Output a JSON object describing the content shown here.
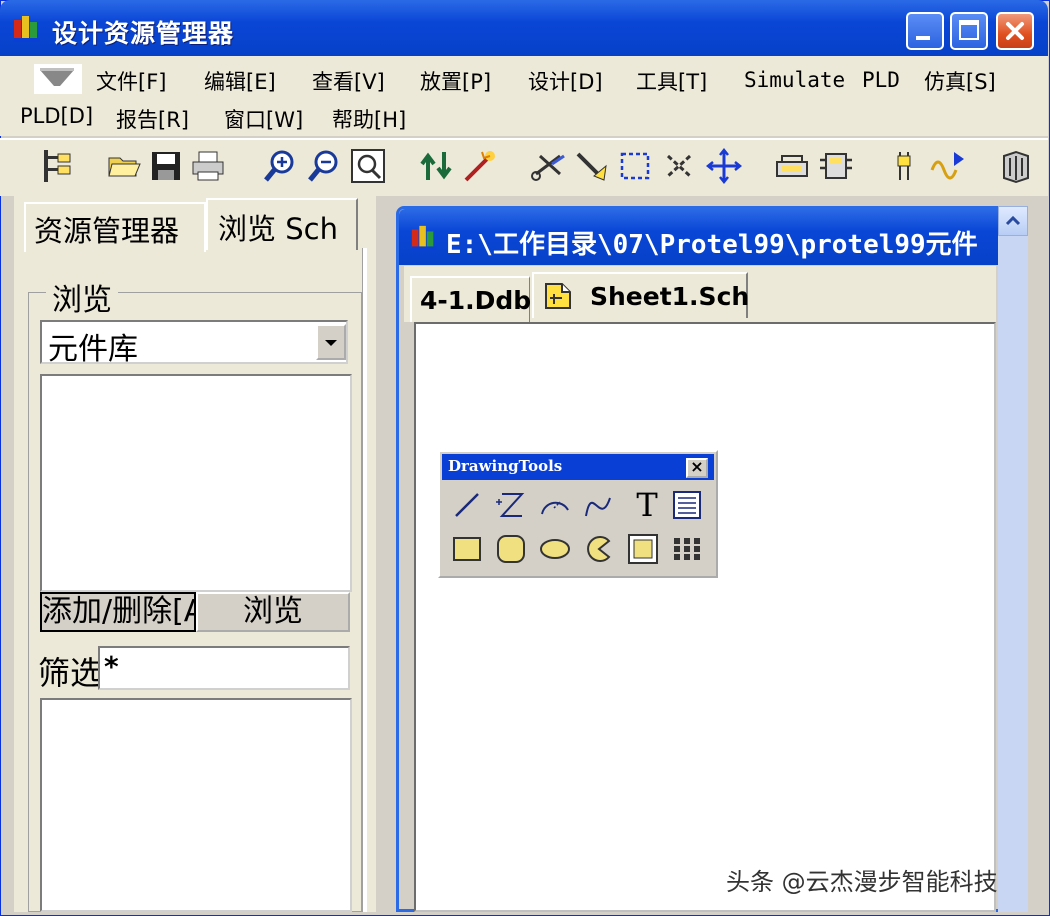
{
  "window": {
    "title": "设计资源管理器",
    "buttons": {
      "minimize": "—",
      "maximize": "□",
      "close": "✕"
    }
  },
  "menu": {
    "items": [
      {
        "label": "文件[F]"
      },
      {
        "label": "编辑[E]"
      },
      {
        "label": "查看[V]"
      },
      {
        "label": "放置[P]"
      },
      {
        "label": "设计[D]"
      },
      {
        "label": "工具[T]"
      },
      {
        "label": "Simulate"
      },
      {
        "label": "PLD"
      },
      {
        "label": "仿真[S]"
      },
      {
        "label": "PLD[D]"
      },
      {
        "label": "报告[R]"
      },
      {
        "label": "窗口[W]"
      },
      {
        "label": "帮助[H]"
      }
    ]
  },
  "toolbar": {
    "icons": [
      "design-tree-icon",
      "open-folder-icon",
      "save-icon",
      "print-icon",
      "zoom-in-icon",
      "zoom-out-icon",
      "zoom-area-icon",
      "hierarchy-up-down-icon",
      "cross-probe-icon",
      "cut-icon",
      "paste-icon",
      "select-area-icon",
      "deselect-icon",
      "move-icon",
      "library-browse-icon",
      "component-icon",
      "wiring-tools-icon",
      "simulate-icon",
      "help-icon"
    ]
  },
  "left_panel": {
    "tabs": [
      {
        "label": "资源管理器"
      },
      {
        "label": "浏览 Sch"
      }
    ],
    "browse_group_label": "浏览",
    "combo_value": "元件库",
    "add_remove_button": "添加/删除[A",
    "browse_button": "浏览",
    "filter_label": "筛选",
    "filter_value": "*"
  },
  "child_window": {
    "title": "E:\\工作目录\\07\\Protel99\\protel99元件",
    "tabs": [
      {
        "label": "4-1.Ddb"
      },
      {
        "label": "Sheet1.Sch"
      }
    ]
  },
  "drawing_tools": {
    "title": "DrawingTools",
    "close_label": "×",
    "text_tool_label": "T"
  },
  "watermark": "头条 @云杰漫步智能科技"
}
